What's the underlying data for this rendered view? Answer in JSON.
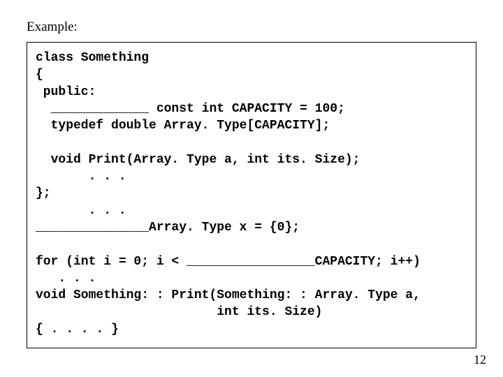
{
  "heading": "Example:",
  "code": "class Something\n{\n public:\n  _____________ const int CAPACITY = 100;\n  typedef double Array. Type[CAPACITY];\n\n  void Print(Array. Type a, int its. Size);\n       . . .\n};\n       . . .\n_______________Array. Type x = {0};\n\nfor (int i = 0; i < _________________CAPACITY; i++)\n   . . .\nvoid Something: : Print(Something: : Array. Type a,\n                        int its. Size)\n{ . . . . }",
  "page_number": "12"
}
